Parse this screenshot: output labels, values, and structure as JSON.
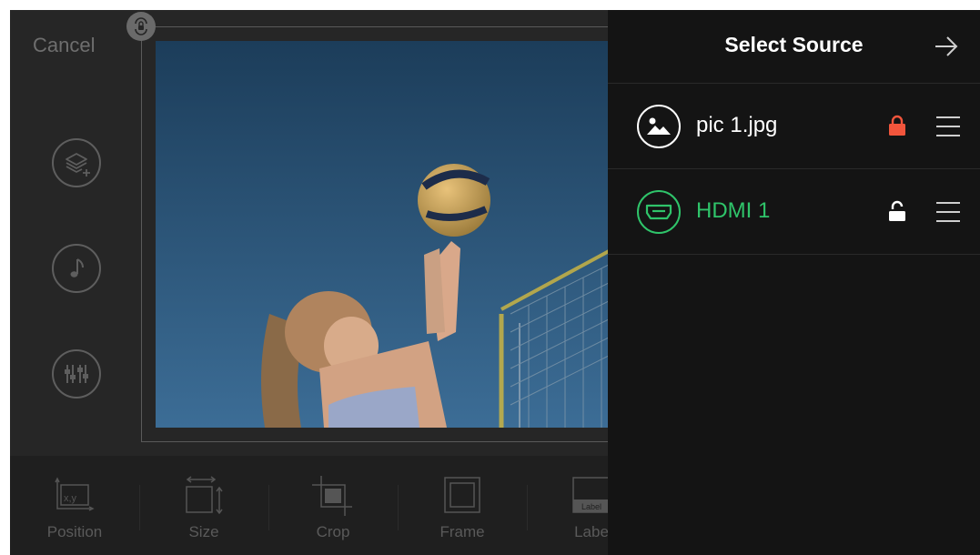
{
  "editor": {
    "cancel_label": "Cancel",
    "side_tools": [
      {
        "icon": "add-layer-icon"
      },
      {
        "icon": "music-note-icon"
      },
      {
        "icon": "mixer-sliders-icon"
      }
    ],
    "canvas": {
      "lock_icon": "lock-badge-icon",
      "image": "volleyball-player-photo"
    }
  },
  "toolbar": {
    "items": [
      {
        "label": "Position",
        "icon": "position-xy-icon",
        "icon_text": "x,y"
      },
      {
        "label": "Size",
        "icon": "resize-icon"
      },
      {
        "label": "Crop",
        "icon": "crop-icon"
      },
      {
        "label": "Frame",
        "icon": "frame-icon"
      },
      {
        "label": "Labe",
        "icon": "label-icon",
        "icon_text": "Label"
      }
    ]
  },
  "panel": {
    "title": "Select Source",
    "next_icon": "arrow-right-icon",
    "sources": [
      {
        "label": "pic 1.jpg",
        "icon": "image-icon",
        "locked": true,
        "color": "#ffffff",
        "lock_color": "#f2553c"
      },
      {
        "label": "HDMI 1",
        "icon": "hdmi-icon",
        "locked": false,
        "color": "#2fc46a",
        "lock_color": "#ffffff"
      }
    ]
  }
}
